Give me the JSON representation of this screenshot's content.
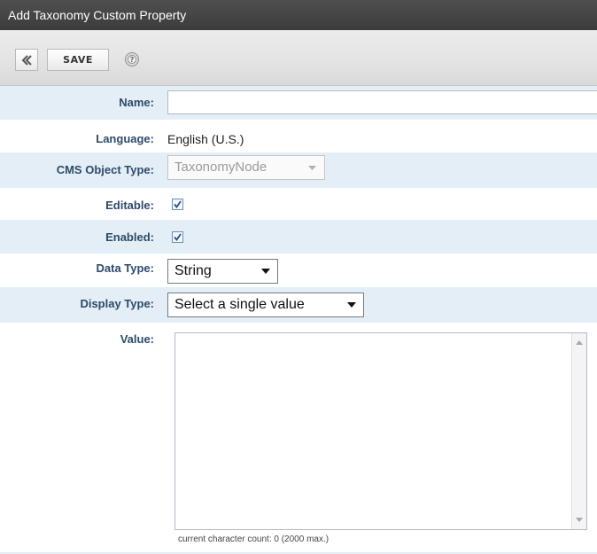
{
  "window": {
    "title": "Add Taxonomy Custom Property"
  },
  "toolbar": {
    "back_icon": "back-arrow-icon",
    "save_label": "SAVE",
    "help_icon": "help-icon"
  },
  "form": {
    "name": {
      "label": "Name:",
      "value": ""
    },
    "language": {
      "label": "Language:",
      "value": "English (U.S.)"
    },
    "cms_object_type": {
      "label": "CMS Object Type:",
      "value": "TaxonomyNode"
    },
    "editable": {
      "label": "Editable:",
      "checked": true
    },
    "enabled": {
      "label": "Enabled:",
      "checked": true
    },
    "data_type": {
      "label": "Data Type:",
      "value": "String"
    },
    "display_type": {
      "label": "Display Type:",
      "value": "Select a single value"
    },
    "value": {
      "label": "Value:",
      "text": "",
      "char_count": "current character count: 0 (2000 max.)"
    }
  },
  "colors": {
    "title_bar": "#3f3f3f",
    "label": "#2c4a6a",
    "alt_row": "#e4eef6"
  }
}
